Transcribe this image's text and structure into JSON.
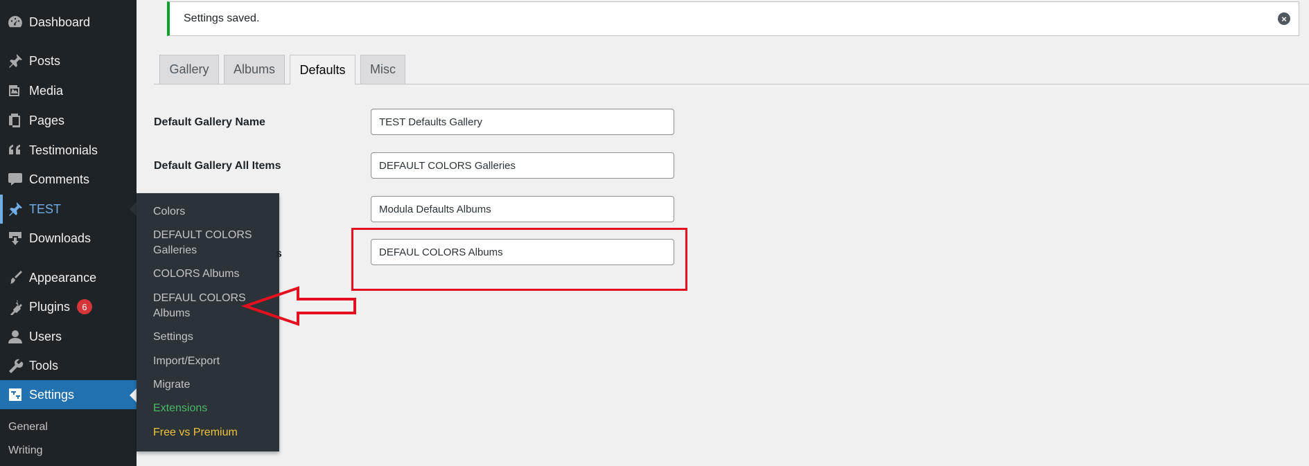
{
  "sidebar": {
    "items": [
      {
        "label": "Dashboard",
        "icon": "dashboard-icon"
      },
      {
        "label": "Posts",
        "icon": "pushpin-icon"
      },
      {
        "label": "Media",
        "icon": "media-icon"
      },
      {
        "label": "Pages",
        "icon": "pages-icon"
      },
      {
        "label": "Testimonials",
        "icon": "quote-icon"
      },
      {
        "label": "Comments",
        "icon": "comment-icon"
      },
      {
        "label": "TEST",
        "icon": "pushpin-icon"
      },
      {
        "label": "Downloads",
        "icon": "download-icon"
      },
      {
        "label": "Appearance",
        "icon": "paintbrush-icon"
      },
      {
        "label": "Plugins",
        "icon": "plugin-icon",
        "badge": "6"
      },
      {
        "label": "Users",
        "icon": "user-icon"
      },
      {
        "label": "Tools",
        "icon": "wrench-icon"
      },
      {
        "label": "Settings",
        "icon": "settings-icon"
      }
    ],
    "submenu": [
      "General",
      "Writing"
    ]
  },
  "flyout": {
    "items": [
      "Colors",
      "DEFAULT COLORS Galleries",
      "COLORS Albums",
      "DEFAUL COLORS Albums",
      "Settings",
      "Import/Export",
      "Migrate",
      "Extensions",
      "Free vs Premium"
    ]
  },
  "notice": {
    "text": "Settings saved."
  },
  "tabs": [
    "Gallery",
    "Albums",
    "Defaults",
    "Misc"
  ],
  "active_tab": "Defaults",
  "form": {
    "fields": [
      {
        "label": "Default Gallery Name",
        "value": "TEST Defaults Gallery"
      },
      {
        "label": "Default Gallery All Items",
        "value": "DEFAULT COLORS Galleries"
      },
      {
        "label": "",
        "value": "Modula Defaults Albums"
      },
      {
        "label": "",
        "value": "DEFAUL COLORS Albums"
      }
    ],
    "partial_label_tail": "s"
  },
  "colors": {
    "sidebar_bg": "#1d2327",
    "accent": "#2271b1",
    "notice_success": "#00a32a",
    "annotation_red": "#e3101f",
    "badge_red": "#d63638"
  }
}
